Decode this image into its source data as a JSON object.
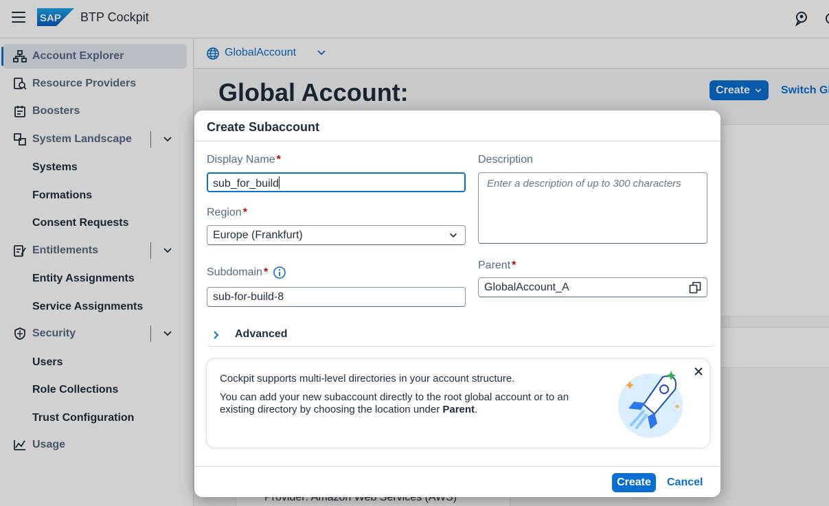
{
  "shell": {
    "brand": "SAP",
    "title": "BTP Cockpit",
    "icons": [
      "hamburger-icon",
      "sap-logo",
      "feedback-icon",
      "user-icon"
    ]
  },
  "sidebar": {
    "items": [
      {
        "label": "Account Explorer",
        "icon": "hierarchy-icon",
        "selected": true
      },
      {
        "label": "Resource Providers",
        "icon": "resource-icon"
      },
      {
        "label": "Boosters",
        "icon": "booster-icon"
      },
      {
        "label": "System Landscape",
        "icon": "landscape-icon",
        "expandable": true
      },
      {
        "label": "Systems",
        "sub": true
      },
      {
        "label": "Formations",
        "sub": true
      },
      {
        "label": "Consent Requests",
        "sub": true
      },
      {
        "label": "Entitlements",
        "icon": "entitlements-icon",
        "expandable": true
      },
      {
        "label": "Entity Assignments",
        "sub": true
      },
      {
        "label": "Service Assignments",
        "sub": true
      },
      {
        "label": "Security",
        "icon": "shield-icon",
        "expandable": true
      },
      {
        "label": "Users",
        "sub": true
      },
      {
        "label": "Role Collections",
        "sub": true
      },
      {
        "label": "Trust Configuration",
        "sub": true
      },
      {
        "label": "Usage",
        "icon": "usage-icon"
      }
    ]
  },
  "main": {
    "breadcrumb": "GlobalAccount",
    "page_title": "Global Account:",
    "create_label": "Create",
    "switch_label": "Switch Glo",
    "bottom_text": "Provider: Amazon Web Services (AWS)"
  },
  "dialog": {
    "title": "Create Subaccount",
    "display_name_label": "Display Name",
    "display_name_value": "sub_for_build",
    "description_label": "Description",
    "description_placeholder": "Enter a description of up to 300 characters",
    "region_label": "Region",
    "region_value": "Europe (Frankfurt)",
    "subdomain_label": "Subdomain",
    "subdomain_value": "sub-for-build-8",
    "parent_label": "Parent",
    "parent_value": "GlobalAccount_A",
    "required_mark": "*",
    "advanced_label": "Advanced",
    "info_line1": "Cockpit supports multi-level directories in your account structure.",
    "info_line2": "You can add your new subaccount directly to the root global account or to an existing directory by choosing the location under ",
    "info_line2_bold": "Parent",
    "info_line2_end": ".",
    "create_button": "Create",
    "cancel_button": "Cancel"
  },
  "colors": {
    "accent": "#0a6ed1",
    "text": "#1d2d3e",
    "required": "#aa0808",
    "label": "#556b82"
  }
}
